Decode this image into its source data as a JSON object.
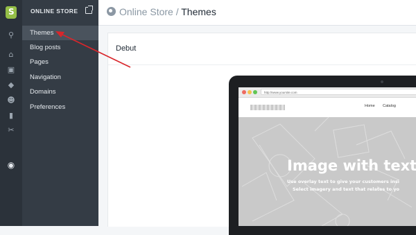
{
  "sidebar": {
    "header": "ONLINE STORE",
    "items": [
      {
        "label": "Themes"
      },
      {
        "label": "Blog posts"
      },
      {
        "label": "Pages"
      },
      {
        "label": "Navigation"
      },
      {
        "label": "Domains"
      },
      {
        "label": "Preferences"
      }
    ]
  },
  "breadcrumb": {
    "parent": "Online Store",
    "separator": " / ",
    "current": "Themes"
  },
  "card": {
    "title": "Debut"
  },
  "preview": {
    "url": "http://www.yoursite.com",
    "nav": [
      "Home",
      "Catalog"
    ],
    "hero_title": "Image with text",
    "hero_lines": [
      "Use overlay text to give your customers insi",
      "Select imagery and text that relates to yo"
    ]
  },
  "colors": {
    "rail": "#2b323a",
    "panel": "#343c45",
    "active": "#4a535d",
    "brand": "#95bf47",
    "arrow": "#d9262b"
  }
}
